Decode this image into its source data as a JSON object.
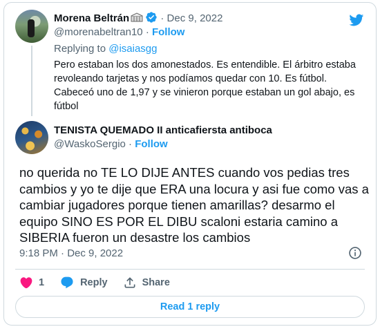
{
  "parent": {
    "display_name": "Morena Beltrán",
    "handle": "@morenabeltran10",
    "dot": "·",
    "follow": "Follow",
    "date": "Dec 9, 2022",
    "replying_prefix": "Replying to ",
    "replying_to": "@isaiasgg",
    "text": "Pero estaban los dos amonestados. Es entendible. El árbitro estaba revoleando tarjetas y nos podíamos quedar con 10. Es fútbol. Cabeceó uno de 1,97 y se vinieron porque estaban un gol abajo, es fútbol"
  },
  "tweet": {
    "display_name": "TENISTA QUEMADO II anticafiersta antiboca",
    "handle": "@WaskoSergio",
    "dot": "·",
    "follow": "Follow",
    "text": "no querida  no  TE LO DIJE ANTES cuando vos pedias tres cambios y yo te dije que ERA una locura y asi fue  como vas a cambiar jugadores porque tienen amarillas? desarmo el equipo SINO ES POR EL DIBU scaloni estaria camino a SIBERIA fueron un desastre los cambios",
    "timestamp": "9:18 PM · Dec 9, 2022"
  },
  "actions": {
    "like_count": "1",
    "reply_label": "Reply",
    "share_label": "Share"
  },
  "read_replies": "Read 1 reply",
  "colors": {
    "accent": "#1d9bf0",
    "like": "#f91880",
    "secondary_text": "#536471",
    "border": "#cfd9de"
  },
  "icons": [
    "twitter-bird-icon",
    "verified-badge-icon",
    "stadium-emoji-icon",
    "info-icon",
    "heart-icon",
    "reply-bubble-icon",
    "share-icon"
  ]
}
